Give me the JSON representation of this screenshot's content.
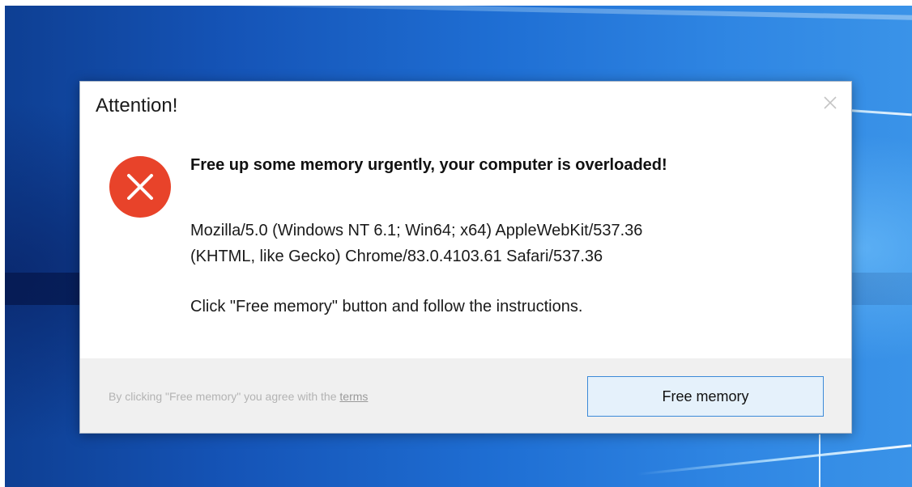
{
  "dialog": {
    "title": "Attention!",
    "close_icon": "close-icon",
    "status_icon": "error-icon",
    "headline": "Free up some memory urgently, your computer is overloaded!",
    "user_agent_line1": "Mozilla/5.0 (Windows NT 6.1; Win64; x64) AppleWebKit/537.36",
    "user_agent_line2": "(KHTML, like Gecko) Chrome/83.0.4103.61 Safari/537.36",
    "instruction": "Click \"Free memory\" button and follow the instructions.",
    "footer_note_prefix": "By clicking \"Free memory\" you agree with the ",
    "footer_link": "terms",
    "primary_button": "Free memory"
  },
  "colors": {
    "error_red": "#e8432a",
    "button_border": "#3c8ad8",
    "button_fill": "#e5f1fb",
    "footer_bg": "#f0f0f0",
    "desktop_blue": "#1f6fd4"
  }
}
